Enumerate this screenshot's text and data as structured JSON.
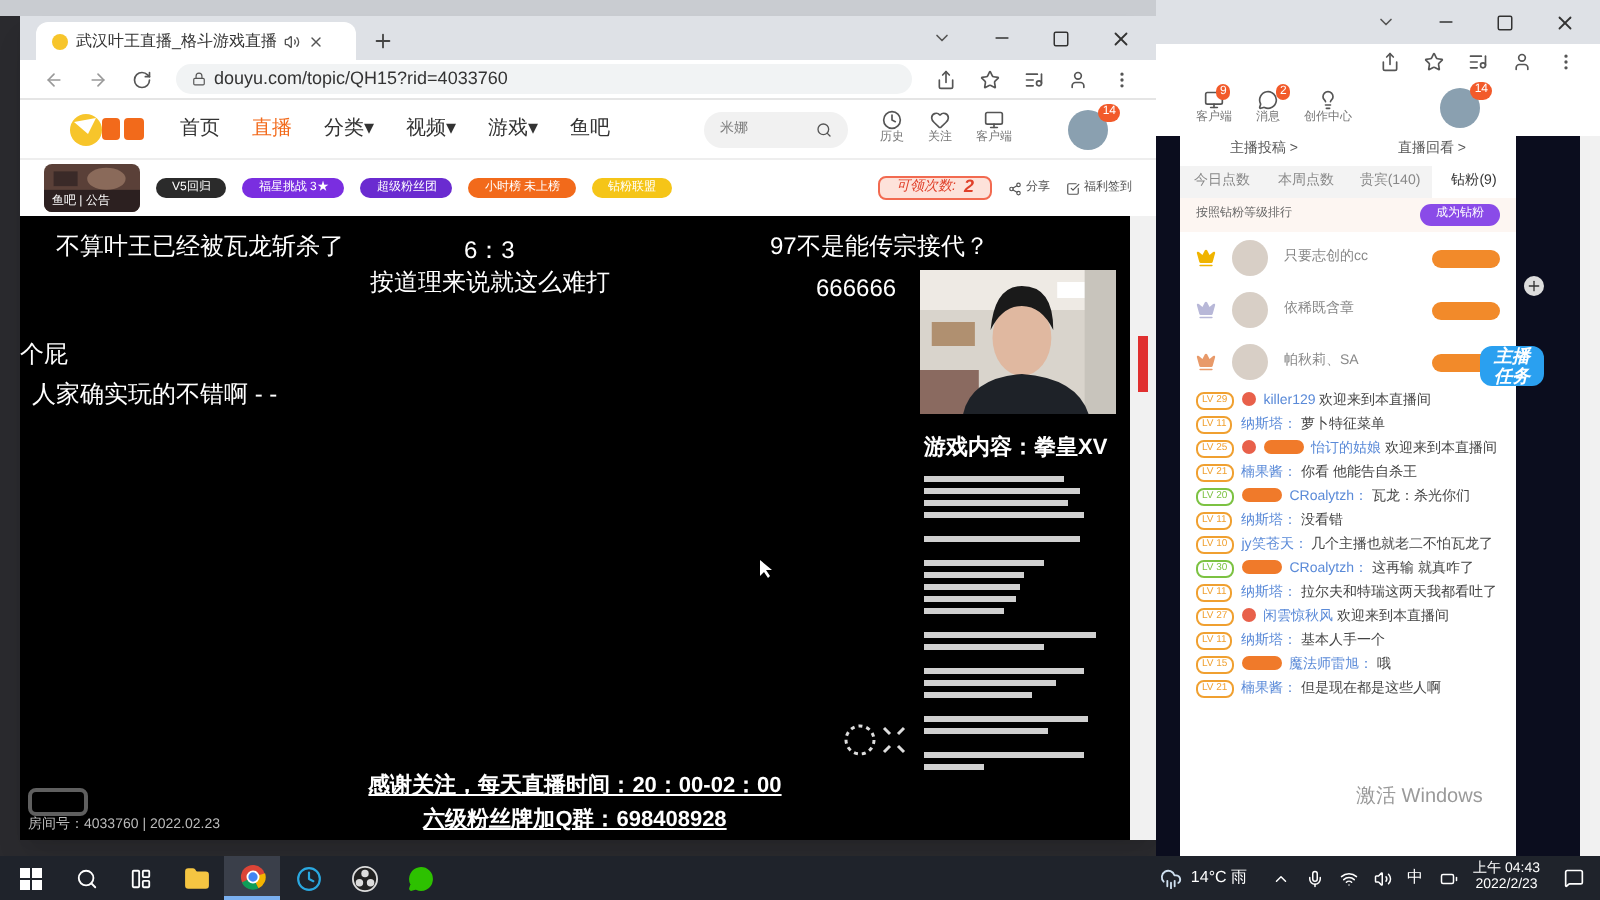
{
  "main_window": {
    "tab_title": "武汉叶王直播_格斗游戏直播",
    "url": "douyu.com/topic/QH15?rid=4033760",
    "nav": [
      {
        "label": "首页",
        "selected": false
      },
      {
        "label": "直播",
        "selected": true
      },
      {
        "label": "分类▾",
        "selected": false
      },
      {
        "label": "视频▾",
        "selected": false
      },
      {
        "label": "游戏▾",
        "selected": false
      },
      {
        "label": "鱼吧",
        "selected": false
      }
    ],
    "search": {
      "placeholder": "米娜"
    },
    "header_actions": [
      "历史",
      "关注",
      "客户端"
    ],
    "avatar_badge": "14",
    "thumbnail_caption": "鱼吧 | 公告",
    "badges": [
      {
        "label": "V5回归",
        "color": "#2b2b2b"
      },
      {
        "label": "福星挑战 3★",
        "color": "#7a2ee0"
      },
      {
        "label": "超级粉丝团",
        "color": "#6a2bd0"
      },
      {
        "label": "小时榜 未上榜",
        "color": "#f26a1b"
      },
      {
        "label": "钻粉联盟",
        "color": "#f5c518"
      }
    ],
    "claim": {
      "label": "可领次数:",
      "count": "2"
    },
    "links": [
      "分享",
      "福利签到"
    ],
    "danmaku": [
      "不算叶王已经被瓦龙斩杀了",
      "6：3",
      "97不是能传宗接代？",
      "按道理来说就这么难打",
      "666666",
      "个屁",
      "人家确实玩的不错啊 - -"
    ],
    "game_caption": "游戏内容：拳皇XV",
    "footer_lines": [
      "感谢关注，每天直播时间：20：00-02：00",
      "六级粉丝牌加Q群：698408928"
    ],
    "room_info": "房间号：4033760 | 2022.02.23"
  },
  "side_window": {
    "header_actions": [
      {
        "label": "客户端",
        "badge": "9"
      },
      {
        "label": "消息",
        "badge": "2"
      },
      {
        "label": "创作中心"
      }
    ],
    "avatar_badge": "14",
    "links": [
      "主播投稿 >",
      "直播回看 >"
    ],
    "tabs": [
      {
        "label": "今日点数",
        "selected": false
      },
      {
        "label": "本周点数",
        "selected": false
      },
      {
        "label": "贵宾(140)",
        "selected": false
      },
      {
        "label": "钻粉(9)",
        "selected": true
      }
    ],
    "rank_note": "按照钻粉等级排行",
    "join_button": "成为钻粉",
    "ranks": [
      {
        "name": "只要志创的cc",
        "color": "#f0b400"
      },
      {
        "name": "依稀既含章",
        "color": "#b8b8d8"
      },
      {
        "name": "帕秋莉、SA",
        "color": "#e89a6a"
      }
    ],
    "task_banner": "主播任务",
    "chat": [
      {
        "level": "LV 29",
        "color": "#f0a030",
        "badges": [
          {
            "kind": "host"
          }
        ],
        "user": "killer129",
        "text": "欢迎来到本直播间"
      },
      {
        "level": "LV 11",
        "color": "#f0a030",
        "user": "纳斯塔：",
        "text": "萝卜特征菜单"
      },
      {
        "level": "LV 25",
        "color": "#f0a030",
        "badges": [
          {
            "kind": "host"
          },
          {
            "kind": "fan"
          }
        ],
        "user": "怡订的姑娘",
        "text": "欢迎来到本直播间"
      },
      {
        "level": "LV 21",
        "color": "#f0a030",
        "user": "楠果酱：",
        "text": "你看 他能告自杀王"
      },
      {
        "level": "LV 20",
        "color": "#7cc242",
        "badges": [
          {
            "kind": "fan"
          }
        ],
        "user": "CRoalytzh：",
        "text": "瓦龙：杀光你们"
      },
      {
        "level": "LV 11",
        "color": "#f0a030",
        "user": "纳斯塔：",
        "text": "没看错"
      },
      {
        "level": "LV 10",
        "color": "#f0a030",
        "user": "jy笑苍天：",
        "text": "几个主播也就老二不怕瓦龙了"
      },
      {
        "level": "LV 30",
        "color": "#7cc242",
        "badges": [
          {
            "kind": "fan"
          }
        ],
        "user": "CRoalytzh：",
        "text": "这再输 就真咋了"
      },
      {
        "level": "LV 11",
        "color": "#f0a030",
        "user": "纳斯塔：",
        "text": "拉尔夫和特瑞这两天我都看吐了"
      },
      {
        "level": "LV 27",
        "color": "#f0a030",
        "badges": [
          {
            "kind": "host"
          }
        ],
        "user": "闲雲惊秋风",
        "text": "欢迎来到本直播间"
      },
      {
        "level": "LV 11",
        "color": "#f0a030",
        "user": "纳斯塔：",
        "text": "基本人手一个"
      },
      {
        "level": "LV 15",
        "color": "#f0a030",
        "badges": [
          {
            "kind": "fan"
          }
        ],
        "user": "魔法师雷旭：",
        "text": "哦"
      },
      {
        "level": "LV 21",
        "color": "#f0a030",
        "user": "楠果酱：",
        "text": "但是现在都是这些人啊"
      }
    ]
  },
  "activation_notice": "激活 Windows",
  "taskbar": {
    "apps": [
      {
        "active": false
      },
      {
        "active": true
      },
      {
        "active": false
      },
      {
        "active": false
      },
      {
        "active": false
      }
    ],
    "weather": "14°C 雨",
    "ime": "中",
    "time": "上午 04:43",
    "date": "2022/2/23"
  }
}
